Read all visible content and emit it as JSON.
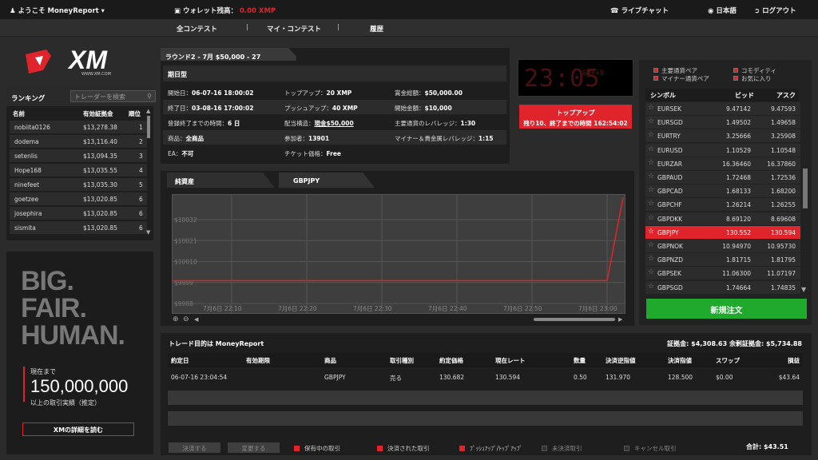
{
  "topbar": {
    "welcome": "ようこそ MoneyReport",
    "wallet_label": "ウォレット残高：",
    "wallet_value": "0.00 XMP",
    "live_chat": "ライブチャット",
    "language": "日本語",
    "logout": "ログアウト"
  },
  "nav": {
    "all_contests": "全コンテスト",
    "my_contests": "マイ・コンテスト",
    "history": "履歴",
    "sep": "|"
  },
  "logo": {
    "text": "XM",
    "url": "WWW.XM.COM"
  },
  "ranking": {
    "title": "ランキング",
    "search_placeholder": "トレーダーを検索",
    "col_name": "名前",
    "col_equity": "有効証拠金",
    "col_rank": "順位",
    "rows": [
      {
        "name": "nobiita0126",
        "equity": "$13,278.38",
        "rank": "1"
      },
      {
        "name": "dodema",
        "equity": "$13,116.40",
        "rank": "2"
      },
      {
        "name": "setenlis",
        "equity": "$13,094.35",
        "rank": "3"
      },
      {
        "name": "Hope168",
        "equity": "$13,035.55",
        "rank": "4"
      },
      {
        "name": "ninefeet",
        "equity": "$13,035.30",
        "rank": "5"
      },
      {
        "name": "goetzee",
        "equity": "$13,020.85",
        "rank": "6"
      },
      {
        "name": "josephira",
        "equity": "$13,020.85",
        "rank": "6"
      },
      {
        "name": "sismita",
        "equity": "$13,020.85",
        "rank": "6"
      }
    ]
  },
  "promo": {
    "line1": "BIG.",
    "line2": "FAIR.",
    "line3": "HUMAN.",
    "now": "現在まで",
    "amount": "150,000,000",
    "sub": "以上の取引実績（推定）",
    "button": "XMの詳細を読む"
  },
  "round": {
    "tab": "ラウンド2 - 7月 $50,000 - 27",
    "period": "期日型",
    "rows": [
      [
        {
          "k": "開始日：",
          "v": "06-07-16 18:00:02"
        },
        {
          "k": "トップアップ：",
          "v": "20 XMP"
        },
        {
          "k": "賞金総額：",
          "v": "$50,000.00"
        }
      ],
      [
        {
          "k": "終了日：",
          "v": "03-08-16 17:00:02"
        },
        {
          "k": "プッシュアップ：",
          "v": "40 XMP"
        },
        {
          "k": "開始金額：",
          "v": "$10,000"
        }
      ],
      [
        {
          "k": "登録終了までの時間：",
          "v": "6 日"
        },
        {
          "k": "配当構造：",
          "v": "現金$50,000"
        },
        {
          "k": "主要通貨のレバレッジ：",
          "v": "1:30"
        }
      ],
      [
        {
          "k": "商品：",
          "v": "全商品"
        },
        {
          "k": "参加者：",
          "v": "13901"
        },
        {
          "k": "マイナー＆貴金属レバレッジ：",
          "v": "1:15"
        }
      ],
      [
        {
          "k": "EA：",
          "v": "不可"
        },
        {
          "k": "チケット価格：",
          "v": "Free"
        },
        {
          "k": "",
          "v": ""
        }
      ]
    ]
  },
  "clock": {
    "time": "23:05",
    "tz": "GMT+9"
  },
  "topup": {
    "label": "トップアップ",
    "remaining": "残り10、終了までの時間 162:54:02"
  },
  "chart": {
    "tab_equity": "純資産",
    "tab_symbol": "GBPJPY"
  },
  "chart_data": {
    "type": "line",
    "x": [
      "7月6日 22:10",
      "7月6日 22:20",
      "7月6日 22:30",
      "7月6日 22:40",
      "7月6日 22:50",
      "7月6日 23:00",
      "7月6日 23:05"
    ],
    "values": [
      10000,
      10000,
      10000,
      10000,
      10000,
      10000,
      10043.64
    ],
    "ytick_labels": [
      "$10032",
      "$10021",
      "$10010",
      "$9999",
      "$9988"
    ],
    "yticks": [
      10032,
      10021,
      10010,
      9999,
      9988
    ],
    "ylim": [
      9983,
      10045
    ],
    "grid": true,
    "color": "#e0242b"
  },
  "symbols": {
    "legend": {
      "major": "主要通貨ペア",
      "minor": "マイナー通貨ペア",
      "commodity": "コモディティ",
      "favorite": "お気に入り"
    },
    "col_symbol": "シンボル",
    "col_bid": "ビッド",
    "col_ask": "アスク",
    "rows": [
      {
        "s": "EURSEK",
        "bid": "9.47142",
        "ask": "9.47593"
      },
      {
        "s": "EURSGD",
        "bid": "1.49502",
        "ask": "1.49658"
      },
      {
        "s": "EURTRY",
        "bid": "3.25666",
        "ask": "3.25908"
      },
      {
        "s": "EURUSD",
        "bid": "1.10529",
        "ask": "1.10548"
      },
      {
        "s": "EURZAR",
        "bid": "16.36460",
        "ask": "16.37860"
      },
      {
        "s": "GBPAUD",
        "bid": "1.72468",
        "ask": "1.72536"
      },
      {
        "s": "GBPCAD",
        "bid": "1.68133",
        "ask": "1.68200"
      },
      {
        "s": "GBPCHF",
        "bid": "1.26214",
        "ask": "1.26255"
      },
      {
        "s": "GBPDKK",
        "bid": "8.69120",
        "ask": "8.69608"
      },
      {
        "s": "GBPJPY",
        "bid": "130.552",
        "ask": "130.594"
      },
      {
        "s": "GBPNOK",
        "bid": "10.94970",
        "ask": "10.95730"
      },
      {
        "s": "GBPNZD",
        "bid": "1.81715",
        "ask": "1.81795"
      },
      {
        "s": "GBPSEK",
        "bid": "11.06300",
        "ask": "11.07197"
      },
      {
        "s": "GBPSGD",
        "bid": "1.74664",
        "ask": "1.74835"
      }
    ],
    "new_order": "新規注文"
  },
  "trade": {
    "title": "トレード目的は MoneyReport",
    "balance": "証拠金: $4,308.63 余剰証拠金: $5,734.88",
    "cols": [
      "約定日",
      "有効期限",
      "商品",
      "取引種別",
      "約定価格",
      "現在レート",
      "数量",
      "決済逆指値",
      "決済指値",
      "スワップ",
      "損益"
    ],
    "row": [
      "06-07-16 23:04:54",
      "",
      "GBPJPY",
      "売る",
      "130.682",
      "130.594",
      "0.50",
      "131.970",
      "128.500",
      "$0.00",
      "$43.64"
    ],
    "btn_close": "決済する",
    "btn_modify": "変更する",
    "f_open": "保有中の取引",
    "f_closed": "決済された取引",
    "f_push": "ﾌﾟｯｼｭｱｯﾌﾟ/ﾄｯﾌﾟｱｯﾌﾟ",
    "f_pending": "未決済取引",
    "f_cancel": "キャンセル取引",
    "total": "合計: $43.51"
  }
}
